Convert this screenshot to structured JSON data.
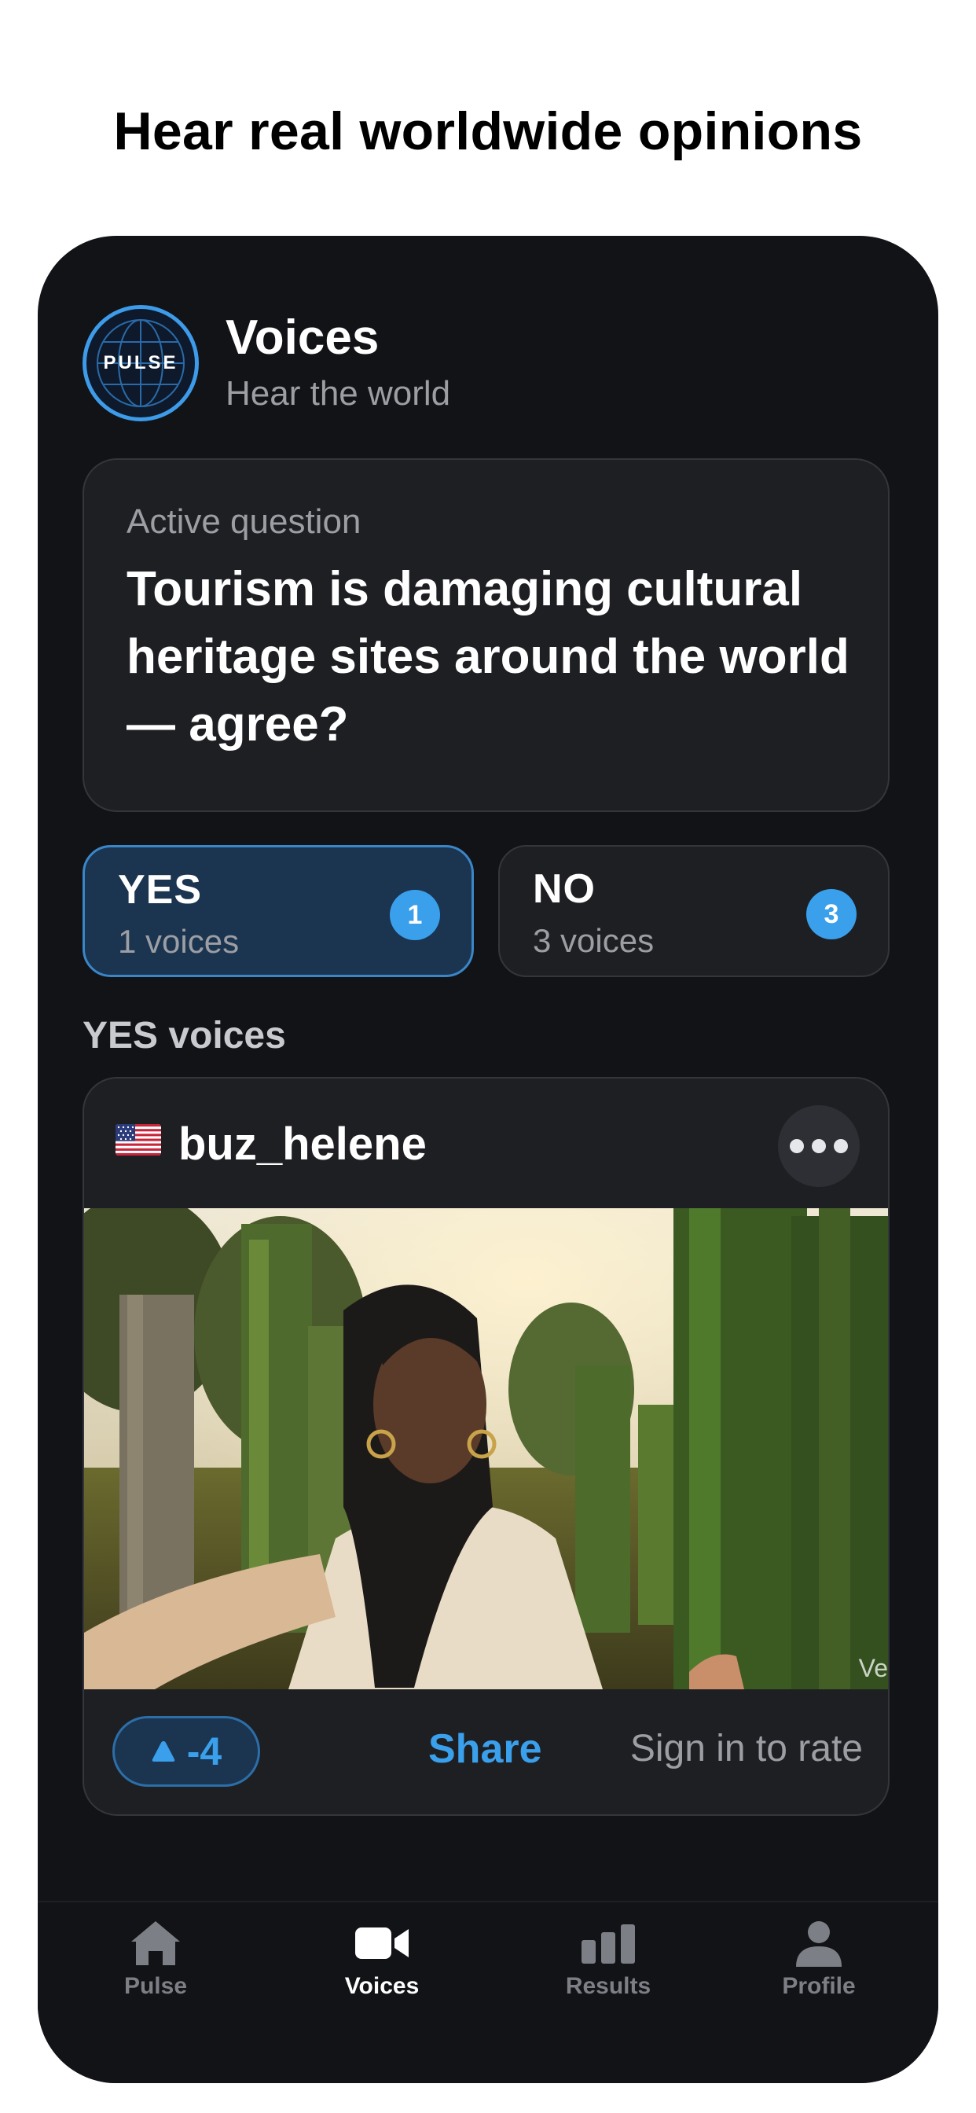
{
  "headline": "Hear real worldwide opinions",
  "header": {
    "logo_text": "PULSE",
    "title": "Voices",
    "subtitle": "Hear the world"
  },
  "question": {
    "label": "Active question",
    "text": "Tourism is damaging cultural heritage sites around the world — agree?"
  },
  "votes": {
    "yes": {
      "label": "YES",
      "count_text": "1 voices",
      "badge": "1"
    },
    "no": {
      "label": "NO",
      "count_text": "3 voices",
      "badge": "3"
    }
  },
  "section_title": "YES voices",
  "voice": {
    "flag_icon": "us-flag-icon",
    "username": "buz_helene",
    "more_icon": "ellipsis-icon",
    "video_watermark": "Ve",
    "score": "-4",
    "score_icon": "triangle-up-icon",
    "share_label": "Share",
    "rate_text": "Sign in to rate"
  },
  "tabs": [
    {
      "label": "Pulse",
      "icon": "home-icon"
    },
    {
      "label": "Voices",
      "icon": "video-camera-icon"
    },
    {
      "label": "Results",
      "icon": "bar-chart-icon"
    },
    {
      "label": "Profile",
      "icon": "person-icon"
    }
  ],
  "colors": {
    "accent": "#3aa0ec",
    "card_bg": "#1e1f23",
    "phone_bg": "#121316",
    "yes_bg": "#1b3450"
  }
}
